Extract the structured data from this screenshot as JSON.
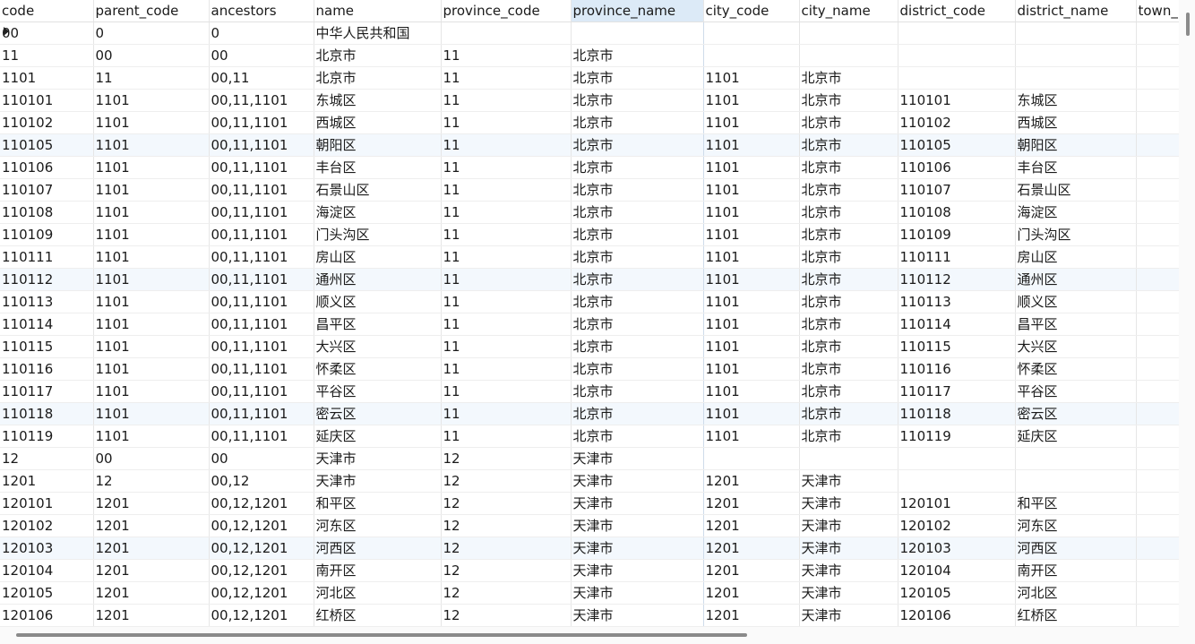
{
  "columns": [
    "code",
    "parent_code",
    "ancestors",
    "name",
    "province_code",
    "province_name",
    "city_code",
    "city_name",
    "district_code",
    "district_name",
    "town_"
  ],
  "rows": [
    [
      "00",
      "0",
      "0",
      "中华人民共和国",
      "",
      "",
      "",
      "",
      "",
      "",
      ""
    ],
    [
      "11",
      "00",
      "00",
      "北京市",
      "11",
      "北京市",
      "",
      "",
      "",
      "",
      ""
    ],
    [
      "1101",
      "11",
      "00,11",
      "北京市",
      "11",
      "北京市",
      "1101",
      "北京市",
      "",
      "",
      ""
    ],
    [
      "110101",
      "1101",
      "00,11,1101",
      "东城区",
      "11",
      "北京市",
      "1101",
      "北京市",
      "110101",
      "东城区",
      ""
    ],
    [
      "110102",
      "1101",
      "00,11,1101",
      "西城区",
      "11",
      "北京市",
      "1101",
      "北京市",
      "110102",
      "西城区",
      ""
    ],
    [
      "110105",
      "1101",
      "00,11,1101",
      "朝阳区",
      "11",
      "北京市",
      "1101",
      "北京市",
      "110105",
      "朝阳区",
      ""
    ],
    [
      "110106",
      "1101",
      "00,11,1101",
      "丰台区",
      "11",
      "北京市",
      "1101",
      "北京市",
      "110106",
      "丰台区",
      ""
    ],
    [
      "110107",
      "1101",
      "00,11,1101",
      "石景山区",
      "11",
      "北京市",
      "1101",
      "北京市",
      "110107",
      "石景山区",
      ""
    ],
    [
      "110108",
      "1101",
      "00,11,1101",
      "海淀区",
      "11",
      "北京市",
      "1101",
      "北京市",
      "110108",
      "海淀区",
      ""
    ],
    [
      "110109",
      "1101",
      "00,11,1101",
      "门头沟区",
      "11",
      "北京市",
      "1101",
      "北京市",
      "110109",
      "门头沟区",
      ""
    ],
    [
      "110111",
      "1101",
      "00,11,1101",
      "房山区",
      "11",
      "北京市",
      "1101",
      "北京市",
      "110111",
      "房山区",
      ""
    ],
    [
      "110112",
      "1101",
      "00,11,1101",
      "通州区",
      "11",
      "北京市",
      "1101",
      "北京市",
      "110112",
      "通州区",
      ""
    ],
    [
      "110113",
      "1101",
      "00,11,1101",
      "顺义区",
      "11",
      "北京市",
      "1101",
      "北京市",
      "110113",
      "顺义区",
      ""
    ],
    [
      "110114",
      "1101",
      "00,11,1101",
      "昌平区",
      "11",
      "北京市",
      "1101",
      "北京市",
      "110114",
      "昌平区",
      ""
    ],
    [
      "110115",
      "1101",
      "00,11,1101",
      "大兴区",
      "11",
      "北京市",
      "1101",
      "北京市",
      "110115",
      "大兴区",
      ""
    ],
    [
      "110116",
      "1101",
      "00,11,1101",
      "怀柔区",
      "11",
      "北京市",
      "1101",
      "北京市",
      "110116",
      "怀柔区",
      ""
    ],
    [
      "110117",
      "1101",
      "00,11,1101",
      "平谷区",
      "11",
      "北京市",
      "1101",
      "北京市",
      "110117",
      "平谷区",
      ""
    ],
    [
      "110118",
      "1101",
      "00,11,1101",
      "密云区",
      "11",
      "北京市",
      "1101",
      "北京市",
      "110118",
      "密云区",
      ""
    ],
    [
      "110119",
      "1101",
      "00,11,1101",
      "延庆区",
      "11",
      "北京市",
      "1101",
      "北京市",
      "110119",
      "延庆区",
      ""
    ],
    [
      "12",
      "00",
      "00",
      "天津市",
      "12",
      "天津市",
      "",
      "",
      "",
      "",
      ""
    ],
    [
      "1201",
      "12",
      "00,12",
      "天津市",
      "12",
      "天津市",
      "1201",
      "天津市",
      "",
      "",
      ""
    ],
    [
      "120101",
      "1201",
      "00,12,1201",
      "和平区",
      "12",
      "天津市",
      "1201",
      "天津市",
      "120101",
      "和平区",
      ""
    ],
    [
      "120102",
      "1201",
      "00,12,1201",
      "河东区",
      "12",
      "天津市",
      "1201",
      "天津市",
      "120102",
      "河东区",
      ""
    ],
    [
      "120103",
      "1201",
      "00,12,1201",
      "河西区",
      "12",
      "天津市",
      "1201",
      "天津市",
      "120103",
      "河西区",
      ""
    ],
    [
      "120104",
      "1201",
      "00,12,1201",
      "南开区",
      "12",
      "天津市",
      "1201",
      "天津市",
      "120104",
      "南开区",
      ""
    ],
    [
      "120105",
      "1201",
      "00,12,1201",
      "河北区",
      "12",
      "天津市",
      "1201",
      "天津市",
      "120105",
      "河北区",
      ""
    ],
    [
      "120106",
      "1201",
      "00,12,1201",
      "红桥区",
      "12",
      "天津市",
      "1201",
      "天津市",
      "120106",
      "红桥区",
      ""
    ]
  ],
  "selected_column": "province_name",
  "current_row_index": 0,
  "highlighted_row_indexes": [
    5,
    11,
    17,
    23
  ],
  "colors": {
    "selected_column_header": "#dceaf7",
    "highlighted_row": "#f3f8fd",
    "scrollbar_thumb": "#8a8a8a"
  }
}
